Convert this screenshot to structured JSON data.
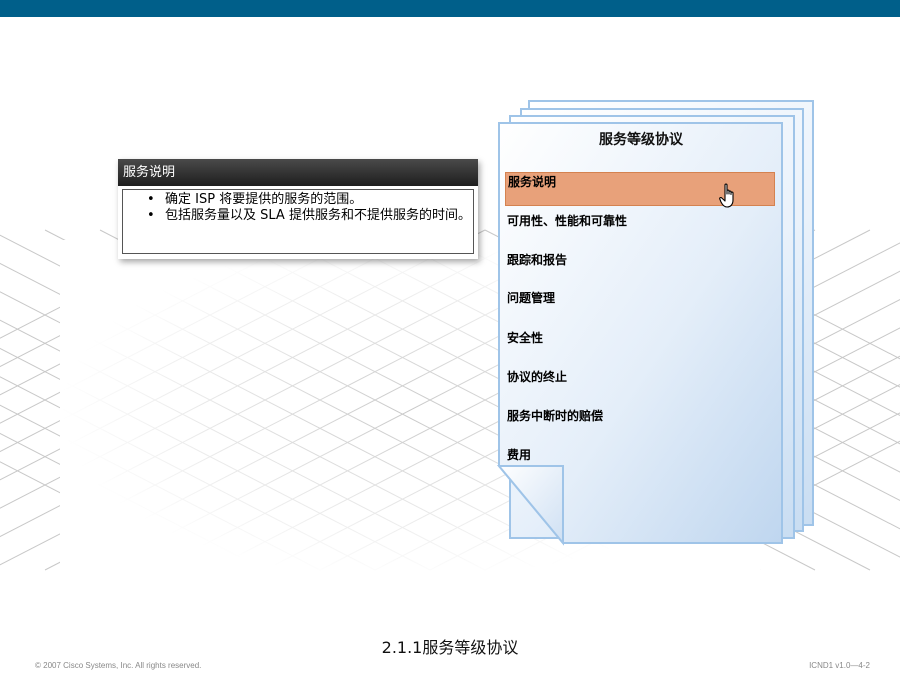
{
  "document": {
    "title": "服务等级协议",
    "items": [
      {
        "label": "服务说明"
      },
      {
        "label": "可用性、性能和可靠性"
      },
      {
        "label": "跟踪和报告"
      },
      {
        "label": "问题管理"
      },
      {
        "label": "安全性"
      },
      {
        "label": "协议的终止"
      },
      {
        "label": "服务中断时的赔偿"
      },
      {
        "label": "费用"
      }
    ],
    "active_index": 0
  },
  "popup": {
    "title": "服务说明",
    "bullet_symbol": "•",
    "bullets": [
      "确定 ISP 将要提供的服务的范围。",
      "包括服务量以及 SLA 提供服务和不提供服务的时间。"
    ]
  },
  "caption": "2.1.1服务等级协议",
  "footer": {
    "copyright": "© 2007 Cisco Systems, Inc. All rights reserved.",
    "course": "ICND1 v1.0—4-2"
  },
  "colors": {
    "top_bar": "#005f8a",
    "active_item": "#e8a17a",
    "page_border": "#9fc4e8"
  }
}
